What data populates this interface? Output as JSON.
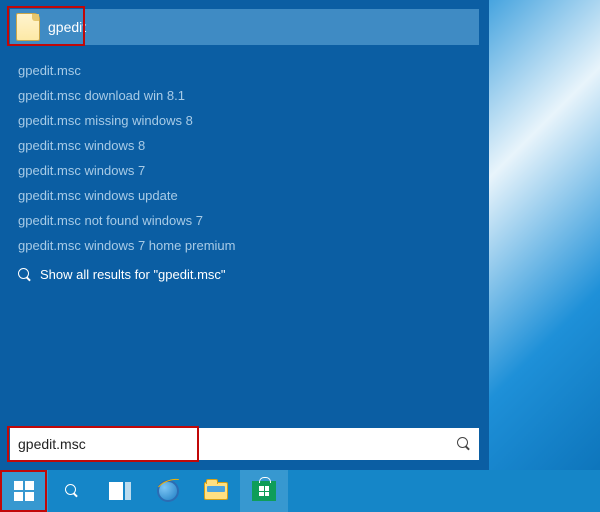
{
  "top_result": {
    "label": "gpedit"
  },
  "suggestions": [
    "gpedit.msc",
    "gpedit.msc download win 8.1",
    "gpedit.msc missing windows 8",
    "gpedit.msc windows 8",
    "gpedit.msc windows 7",
    "gpedit.msc windows update",
    "gpedit.msc not found windows 7",
    "gpedit.msc windows 7 home premium"
  ],
  "show_all": {
    "prefix": "Show all results for ",
    "query": "\"gpedit.msc\""
  },
  "search": {
    "value": "gpedit.msc"
  },
  "taskbar": {
    "start": "Start",
    "search": "Search",
    "taskview": "Task View",
    "ie": "Internet Explorer",
    "explorer": "File Explorer",
    "store": "Store"
  }
}
